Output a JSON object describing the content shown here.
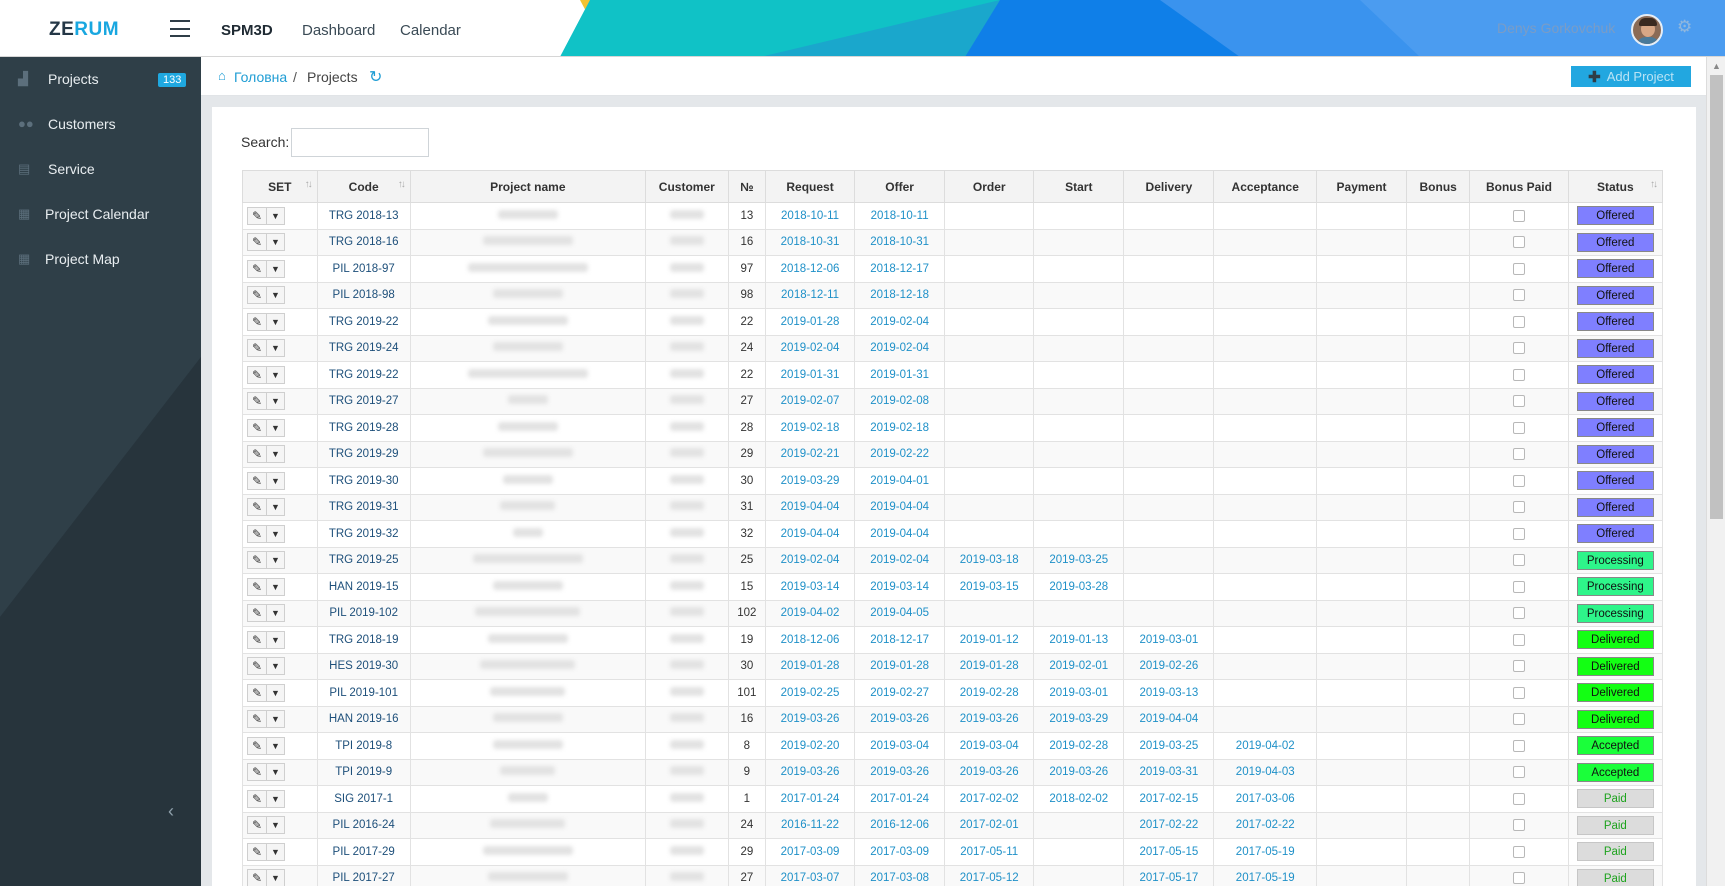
{
  "header": {
    "logo_part1": "ZE",
    "logo_part2": "RUM",
    "brand": "SPM3D",
    "nav": [
      "Dashboard",
      "Calendar"
    ],
    "user_name": "Denys Gorkovchuk",
    "icons": {
      "menu": "hamburger-icon",
      "settings": "gear-icon"
    }
  },
  "sidebar": {
    "items": [
      {
        "label": "Projects",
        "icon": "sitemap-icon",
        "badge": "133"
      },
      {
        "label": "Customers",
        "icon": "users-icon"
      },
      {
        "label": "Service",
        "icon": "file-icon"
      },
      {
        "label": "Project Calendar",
        "icon": "calendar-icon"
      },
      {
        "label": "Project Map",
        "icon": "calendar-icon"
      }
    ]
  },
  "breadcrumb": {
    "home": "Головна",
    "separator": "/",
    "current": "Projects"
  },
  "actions": {
    "add_project": "Add Project"
  },
  "search": {
    "label": "Search:",
    "value": ""
  },
  "colors": {
    "accent": "#1fa8e0",
    "sidebar_bg": "#2c3b44",
    "offered": "#7f7fff",
    "processing": "#2ef58a",
    "delivered": "#13ff13",
    "accepted": "#1aff3a",
    "paid": "#dcdcdc"
  },
  "table": {
    "columns": [
      "SET",
      "Code",
      "Project name",
      "Customer",
      "№",
      "Request",
      "Offer",
      "Order",
      "Start",
      "Delivery",
      "Acceptance",
      "Payment",
      "Bonus",
      "Bonus Paid",
      "Status"
    ],
    "rows": [
      {
        "code": "TRG 2018-13",
        "num": "13",
        "request": "2018-10-11",
        "offer": "2018-10-11",
        "order": "",
        "start": "",
        "delivery": "",
        "acceptance": "",
        "status": "Offered"
      },
      {
        "code": "TRG 2018-16",
        "num": "16",
        "request": "2018-10-31",
        "offer": "2018-10-31",
        "order": "",
        "start": "",
        "delivery": "",
        "acceptance": "",
        "status": "Offered"
      },
      {
        "code": "PIL 2018-97",
        "num": "97",
        "request": "2018-12-06",
        "offer": "2018-12-17",
        "order": "",
        "start": "",
        "delivery": "",
        "acceptance": "",
        "status": "Offered"
      },
      {
        "code": "PIL 2018-98",
        "num": "98",
        "request": "2018-12-11",
        "offer": "2018-12-18",
        "order": "",
        "start": "",
        "delivery": "",
        "acceptance": "",
        "status": "Offered"
      },
      {
        "code": "TRG 2019-22",
        "num": "22",
        "request": "2019-01-28",
        "offer": "2019-02-04",
        "order": "",
        "start": "",
        "delivery": "",
        "acceptance": "",
        "status": "Offered"
      },
      {
        "code": "TRG 2019-24",
        "num": "24",
        "request": "2019-02-04",
        "offer": "2019-02-04",
        "order": "",
        "start": "",
        "delivery": "",
        "acceptance": "",
        "status": "Offered"
      },
      {
        "code": "TRG 2019-22",
        "num": "22",
        "request": "2019-01-31",
        "offer": "2019-01-31",
        "order": "",
        "start": "",
        "delivery": "",
        "acceptance": "",
        "status": "Offered"
      },
      {
        "code": "TRG 2019-27",
        "num": "27",
        "request": "2019-02-07",
        "offer": "2019-02-08",
        "order": "",
        "start": "",
        "delivery": "",
        "acceptance": "",
        "status": "Offered"
      },
      {
        "code": "TRG 2019-28",
        "num": "28",
        "request": "2019-02-18",
        "offer": "2019-02-18",
        "order": "",
        "start": "",
        "delivery": "",
        "acceptance": "",
        "status": "Offered"
      },
      {
        "code": "TRG 2019-29",
        "num": "29",
        "request": "2019-02-21",
        "offer": "2019-02-22",
        "order": "",
        "start": "",
        "delivery": "",
        "acceptance": "",
        "status": "Offered"
      },
      {
        "code": "TRG 2019-30",
        "num": "30",
        "request": "2019-03-29",
        "offer": "2019-04-01",
        "order": "",
        "start": "",
        "delivery": "",
        "acceptance": "",
        "status": "Offered"
      },
      {
        "code": "TRG 2019-31",
        "num": "31",
        "request": "2019-04-04",
        "offer": "2019-04-04",
        "order": "",
        "start": "",
        "delivery": "",
        "acceptance": "",
        "status": "Offered"
      },
      {
        "code": "TRG 2019-32",
        "num": "32",
        "request": "2019-04-04",
        "offer": "2019-04-04",
        "order": "",
        "start": "",
        "delivery": "",
        "acceptance": "",
        "status": "Offered"
      },
      {
        "code": "TRG 2019-25",
        "num": "25",
        "request": "2019-02-04",
        "offer": "2019-02-04",
        "order": "2019-03-18",
        "start": "2019-03-25",
        "delivery": "",
        "acceptance": "",
        "status": "Processing"
      },
      {
        "code": "HAN 2019-15",
        "num": "15",
        "request": "2019-03-14",
        "offer": "2019-03-14",
        "order": "2019-03-15",
        "start": "2019-03-28",
        "delivery": "",
        "acceptance": "",
        "status": "Processing"
      },
      {
        "code": "PIL 2019-102",
        "num": "102",
        "request": "2019-04-02",
        "offer": "2019-04-05",
        "order": "",
        "start": "",
        "delivery": "",
        "acceptance": "",
        "status": "Processing"
      },
      {
        "code": "TRG 2018-19",
        "num": "19",
        "request": "2018-12-06",
        "offer": "2018-12-17",
        "order": "2019-01-12",
        "start": "2019-01-13",
        "delivery": "2019-03-01",
        "acceptance": "",
        "status": "Delivered"
      },
      {
        "code": "HES 2019-30",
        "num": "30",
        "request": "2019-01-28",
        "offer": "2019-01-28",
        "order": "2019-01-28",
        "start": "2019-02-01",
        "delivery": "2019-02-26",
        "acceptance": "",
        "status": "Delivered"
      },
      {
        "code": "PIL 2019-101",
        "num": "101",
        "request": "2019-02-25",
        "offer": "2019-02-27",
        "order": "2019-02-28",
        "start": "2019-03-01",
        "delivery": "2019-03-13",
        "acceptance": "",
        "status": "Delivered"
      },
      {
        "code": "HAN 2019-16",
        "num": "16",
        "request": "2019-03-26",
        "offer": "2019-03-26",
        "order": "2019-03-26",
        "start": "2019-03-29",
        "delivery": "2019-04-04",
        "acceptance": "",
        "status": "Delivered"
      },
      {
        "code": "TPI 2019-8",
        "num": "8",
        "request": "2019-02-20",
        "offer": "2019-03-04",
        "order": "2019-03-04",
        "start": "2019-02-28",
        "delivery": "2019-03-25",
        "acceptance": "2019-04-02",
        "status": "Accepted"
      },
      {
        "code": "TPI 2019-9",
        "num": "9",
        "request": "2019-03-26",
        "offer": "2019-03-26",
        "order": "2019-03-26",
        "start": "2019-03-26",
        "delivery": "2019-03-31",
        "acceptance": "2019-04-03",
        "status": "Accepted"
      },
      {
        "code": "SIG 2017-1",
        "num": "1",
        "request": "2017-01-24",
        "offer": "2017-01-24",
        "order": "2017-02-02",
        "start": "2018-02-02",
        "delivery": "2017-02-15",
        "acceptance": "2017-03-06",
        "status": "Paid"
      },
      {
        "code": "PIL 2016-24",
        "num": "24",
        "request": "2016-11-22",
        "offer": "2016-12-06",
        "order": "2017-02-01",
        "start": "",
        "delivery": "2017-02-22",
        "acceptance": "2017-02-22",
        "status": "Paid"
      },
      {
        "code": "PIL 2017-29",
        "num": "29",
        "request": "2017-03-09",
        "offer": "2017-03-09",
        "order": "2017-05-11",
        "start": "",
        "delivery": "2017-05-15",
        "acceptance": "2017-05-19",
        "status": "Paid"
      },
      {
        "code": "PIL 2017-27",
        "num": "27",
        "request": "2017-03-07",
        "offer": "2017-03-08",
        "order": "2017-05-12",
        "start": "",
        "delivery": "2017-05-17",
        "acceptance": "2017-05-19",
        "status": "Paid"
      }
    ]
  }
}
